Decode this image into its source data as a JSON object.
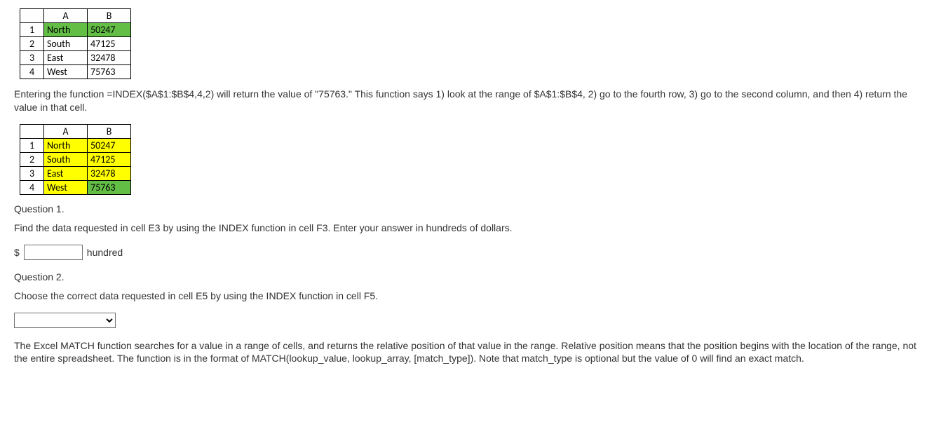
{
  "table1": {
    "colHeaders": [
      "A",
      "B"
    ],
    "rowHeaders": [
      "1",
      "2",
      "3",
      "4"
    ],
    "rows": [
      {
        "a": "North",
        "b": "50247"
      },
      {
        "a": "South",
        "b": "47125"
      },
      {
        "a": "East",
        "b": "32478"
      },
      {
        "a": "West",
        "b": "75763"
      }
    ]
  },
  "para1": "Entering the function =INDEX($A$1:$B$4,4,2) will return the value of \"75763.\" This function says 1) look at the range of $A$1:$B$4, 2) go to the fourth row, 3) go to the second column, and then 4) return the value in that cell.",
  "table2": {
    "colHeaders": [
      "A",
      "B"
    ],
    "rowHeaders": [
      "1",
      "2",
      "3",
      "4"
    ],
    "rows": [
      {
        "a": "North",
        "b": "50247"
      },
      {
        "a": "South",
        "b": "47125"
      },
      {
        "a": "East",
        "b": "32478"
      },
      {
        "a": "West",
        "b": "75763"
      }
    ]
  },
  "q1": {
    "title": "Question 1.",
    "prompt": "Find the data requested in cell E3 by using the INDEX function in cell F3. Enter your answer in hundreds of dollars.",
    "prefix": "$",
    "value": "",
    "suffix": "hundred"
  },
  "q2": {
    "title": "Question 2.",
    "prompt": "Choose the correct data requested in cell E5 by using the INDEX function in cell F5.",
    "selected": ""
  },
  "para2": "The Excel MATCH function searches for a value in a range of cells, and returns the relative position of that value in the range. Relative position means that the position begins with the location of the range, not the entire spreadsheet. The function is in the format of MATCH(lookup_value, lookup_array, [match_type]). Note that match_type is optional but the value of 0 will find an exact match."
}
